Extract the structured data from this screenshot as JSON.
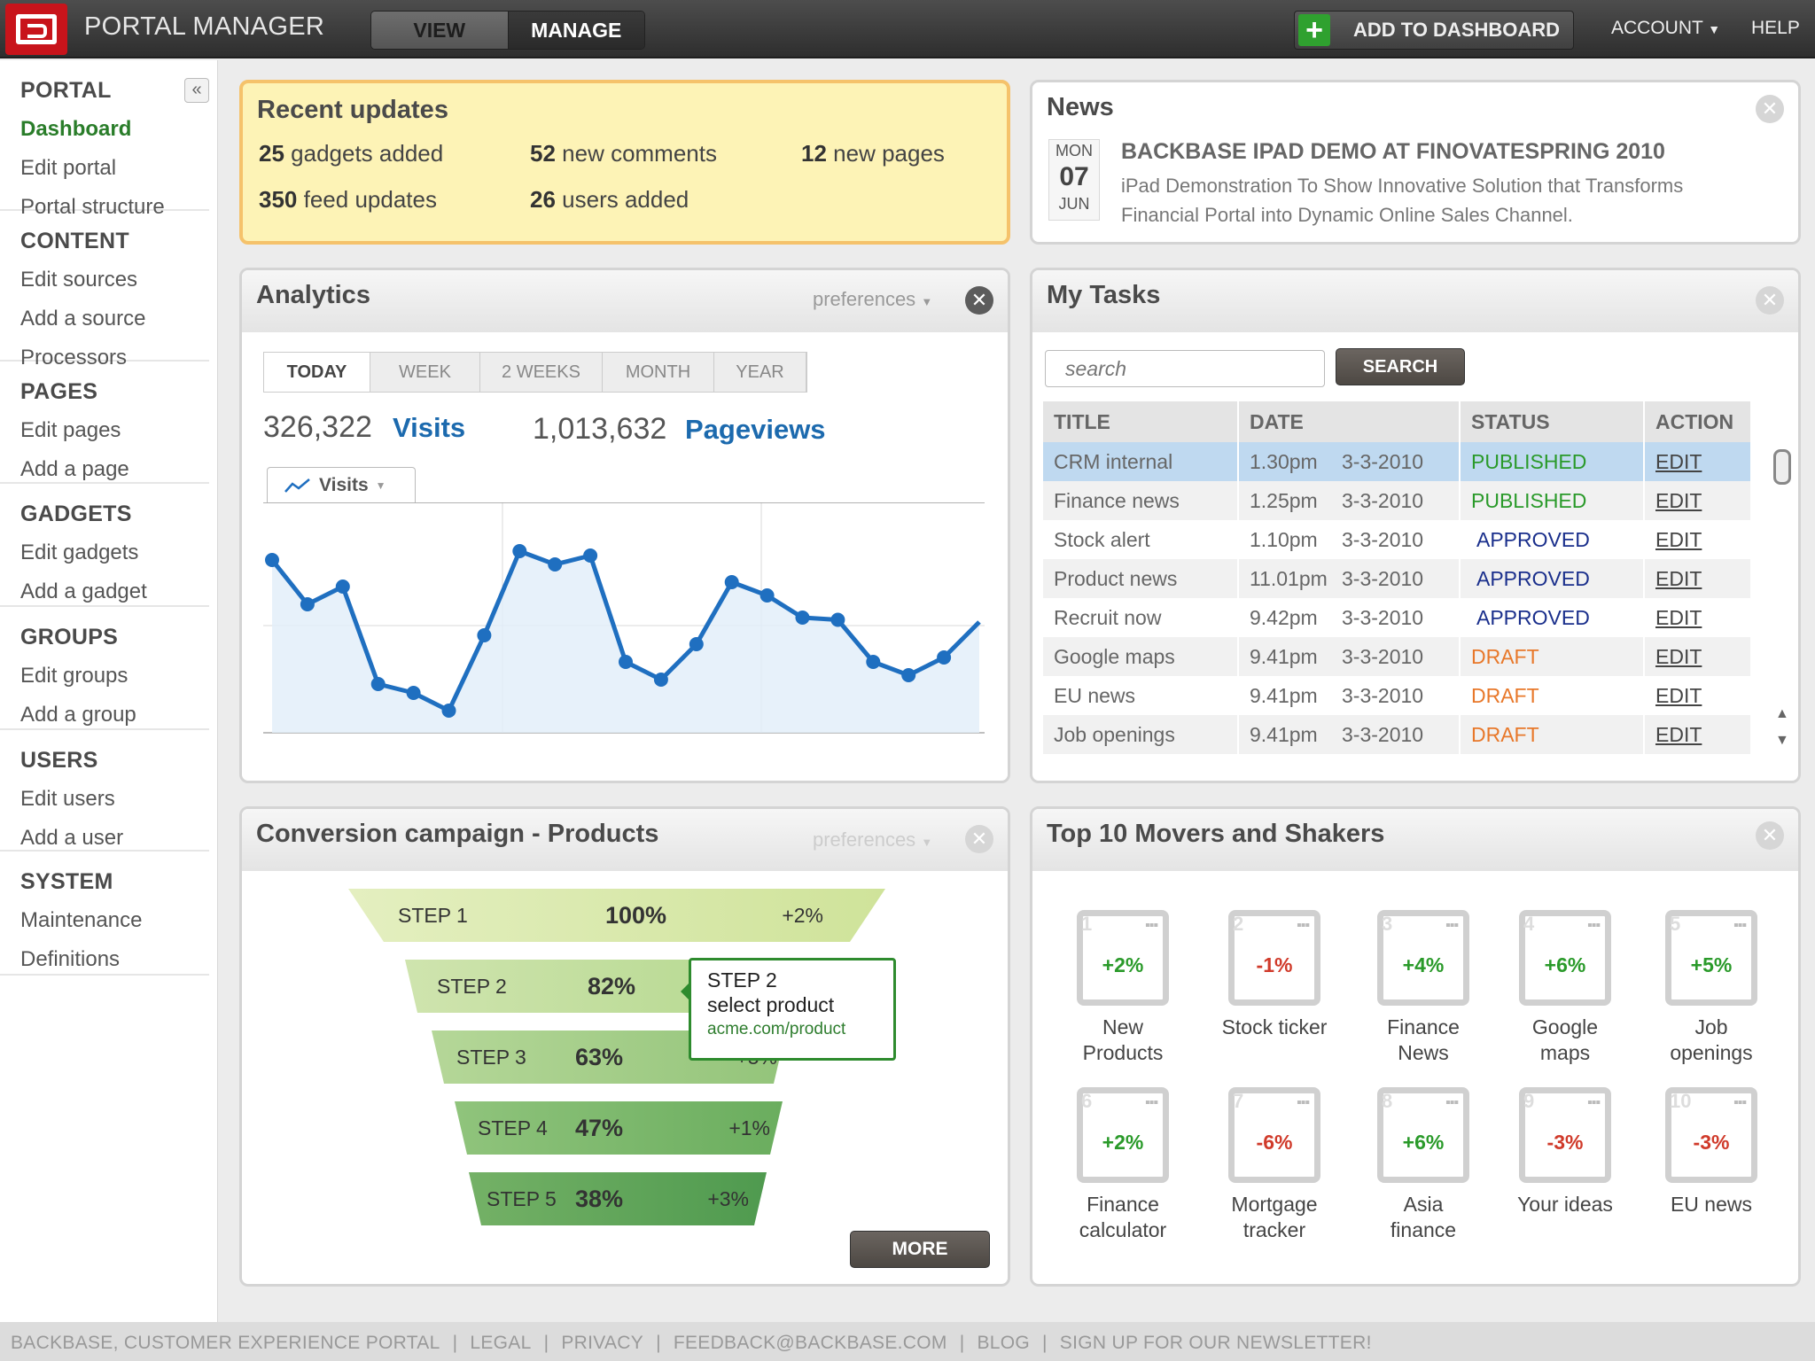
{
  "header": {
    "title": "PORTAL MANAGER",
    "modes": [
      "VIEW",
      "MANAGE"
    ],
    "active_mode": "MANAGE",
    "add_label": "ADD TO DASHBOARD",
    "account_label": "ACCOUNT",
    "help_label": "HELP",
    "collapse_icon": "«"
  },
  "sidebar": [
    {
      "heading": "PORTAL",
      "items": [
        "Dashboard",
        "Edit portal",
        "Portal structure"
      ],
      "active": "Dashboard"
    },
    {
      "heading": "CONTENT",
      "items": [
        "Edit sources",
        "Add a source",
        "Processors"
      ]
    },
    {
      "heading": "PAGES",
      "items": [
        "Edit pages",
        "Add a page"
      ]
    },
    {
      "heading": "GADGETS",
      "items": [
        "Edit gadgets",
        "Add a gadget"
      ]
    },
    {
      "heading": "GROUPS",
      "items": [
        "Edit groups",
        "Add a group"
      ]
    },
    {
      "heading": "USERS",
      "items": [
        "Edit users",
        "Add a user"
      ]
    },
    {
      "heading": "SYSTEM",
      "items": [
        "Maintenance",
        "Definitions"
      ]
    }
  ],
  "recent": {
    "title": "Recent updates",
    "items": [
      {
        "num": "25",
        "text": " gadgets added"
      },
      {
        "num": "52",
        "text": " new comments"
      },
      {
        "num": "12",
        "text": " new pages"
      },
      {
        "num": "350",
        "text": " feed updates"
      },
      {
        "num": "26",
        "text": " users added"
      }
    ]
  },
  "news": {
    "title": "News",
    "day_name": "MON",
    "day": "07",
    "month": "JUN",
    "headline": "BACKBASE IPAD DEMO AT FINOVATESPRING 2010",
    "body": "iPad Demonstration To Show Innovative Solution that  Transforms Financial Portal into Dynamic Online Sales Channel."
  },
  "analytics": {
    "title": "Analytics",
    "preferences": "preferences",
    "tabs": [
      "TODAY",
      "WEEK",
      "2 WEEKS",
      "MONTH",
      "YEAR"
    ],
    "active_tab": "TODAY",
    "visits_num": "326,322",
    "visits_label": "Visits",
    "pageviews_num": "1,013,632",
    "pageviews_label": "Pageviews",
    "chart_tab": "Visits"
  },
  "chart_data": {
    "type": "area",
    "series": [
      {
        "name": "Visits",
        "values": [
          78,
          58,
          66,
          22,
          18,
          10,
          44,
          82,
          76,
          80,
          32,
          24,
          40,
          68,
          62,
          52,
          51,
          32,
          26,
          34,
          50
        ]
      }
    ],
    "ylim": [
      0,
      100
    ],
    "grid": true,
    "line_color": "#1f6fc0",
    "fill_color": "#e3eef9"
  },
  "tasks": {
    "title": "My Tasks",
    "search_placeholder": "search",
    "search_label": "SEARCH",
    "columns": [
      "TITLE",
      "DATE",
      "STATUS",
      "ACTION"
    ],
    "rows": [
      {
        "title": "CRM internal",
        "time": "1.30pm",
        "date": "3-3-2010",
        "status": "PUBLISHED",
        "action": "EDIT"
      },
      {
        "title": "Finance news",
        "time": "1.25pm",
        "date": "3-3-2010",
        "status": "PUBLISHED",
        "action": "EDIT"
      },
      {
        "title": "Stock alert",
        "time": "1.10pm",
        "date": "3-3-2010",
        "status": "APPROVED",
        "action": "EDIT"
      },
      {
        "title": "Product news",
        "time": "11.01pm",
        "date": "3-3-2010",
        "status": "APPROVED",
        "action": "EDIT"
      },
      {
        "title": "Recruit now",
        "time": "9.42pm",
        "date": "3-3-2010",
        "status": "APPROVED",
        "action": "EDIT"
      },
      {
        "title": "Google maps",
        "time": "9.41pm",
        "date": "3-3-2010",
        "status": "DRAFT",
        "action": "EDIT"
      },
      {
        "title": "EU news",
        "time": "9.41pm",
        "date": "3-3-2010",
        "status": "DRAFT",
        "action": "EDIT"
      },
      {
        "title": "Job openings",
        "time": "9.41pm",
        "date": "3-3-2010",
        "status": "DRAFT",
        "action": "EDIT"
      }
    ],
    "status_colors": {
      "PUBLISHED": "#2a9a2a",
      "APPROVED": "#1a2f8c",
      "DRAFT": "#e8782a"
    }
  },
  "conversion": {
    "title": "Conversion campaign - Products",
    "preferences": "preferences",
    "more_label": "MORE",
    "steps": [
      {
        "name": "STEP 1",
        "pct": "100%",
        "delta": "+2%"
      },
      {
        "name": "STEP 2",
        "pct": "82%",
        "delta": ""
      },
      {
        "name": "STEP 3",
        "pct": "63%",
        "delta": "+5%"
      },
      {
        "name": "STEP 4",
        "pct": "47%",
        "delta": "+1%"
      },
      {
        "name": "STEP 5",
        "pct": "38%",
        "delta": "+3%"
      }
    ],
    "tooltip": {
      "line1": "STEP 2",
      "line2": "select product",
      "url": "acme.com/product"
    }
  },
  "movers": {
    "title": "Top 10 Movers and Shakers",
    "items": [
      {
        "n": "1",
        "pct": "+2%",
        "label": "New Products"
      },
      {
        "n": "2",
        "pct": "-1%",
        "label": "Stock ticker"
      },
      {
        "n": "3",
        "pct": "+4%",
        "label": "Finance News"
      },
      {
        "n": "4",
        "pct": "+6%",
        "label": "Google maps"
      },
      {
        "n": "5",
        "pct": "+5%",
        "label": "Job openings"
      },
      {
        "n": "6",
        "pct": "+2%",
        "label": "Finance calculator"
      },
      {
        "n": "7",
        "pct": "-6%",
        "label": "Mortgage tracker"
      },
      {
        "n": "8",
        "pct": "+6%",
        "label": "Asia finance"
      },
      {
        "n": "9",
        "pct": "-3%",
        "label": "Your ideas"
      },
      {
        "n": "10",
        "pct": "-3%",
        "label": "EU news"
      }
    ]
  },
  "footer": [
    "BACKBASE, CUSTOMER EXPERIENCE PORTAL",
    "|",
    "LEGAL",
    "|",
    "PRIVACY",
    "|",
    "FEEDBACK@BACKBASE.COM",
    "|",
    "BLOG",
    "|",
    "SIGN UP FOR OUR NEWSLETTER!"
  ],
  "colors": {
    "positive": "#2a9a2a",
    "negative": "#d03a2a",
    "link": "#1c6aae",
    "active_nav": "#2a7d2a"
  }
}
